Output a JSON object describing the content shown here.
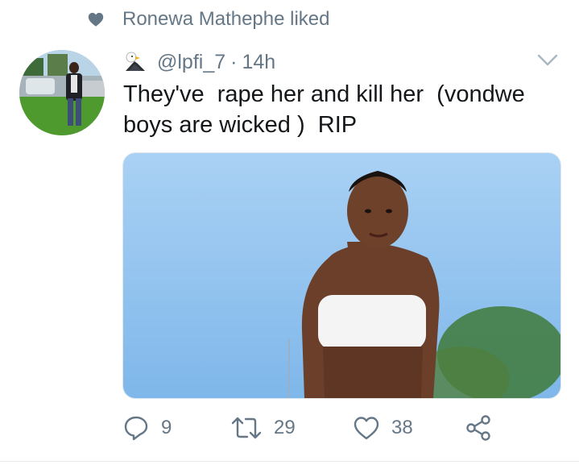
{
  "social_context": {
    "icon": "heart-icon",
    "text": "Ronewa Mathephe liked"
  },
  "tweet": {
    "avatar": "avatar",
    "badge_icon": "eagle-icon",
    "handle": "@lpfi_7",
    "separator": "·",
    "time": "14h",
    "menu_icon": "chevron-down-icon",
    "text": "They've  rape her and kill her  (vondwe boys are wicked )  RIP",
    "media_description": "photo-attachment"
  },
  "actions": {
    "reply": {
      "icon": "reply-icon",
      "count": "9"
    },
    "retweet": {
      "icon": "retweet-icon",
      "count": "29"
    },
    "like": {
      "icon": "heart-outline-icon",
      "count": "38"
    },
    "share": {
      "icon": "share-icon"
    }
  },
  "colors": {
    "text": "#14171a",
    "secondary": "#657786",
    "icon": "#657786",
    "sky": "#8fc2ef"
  }
}
